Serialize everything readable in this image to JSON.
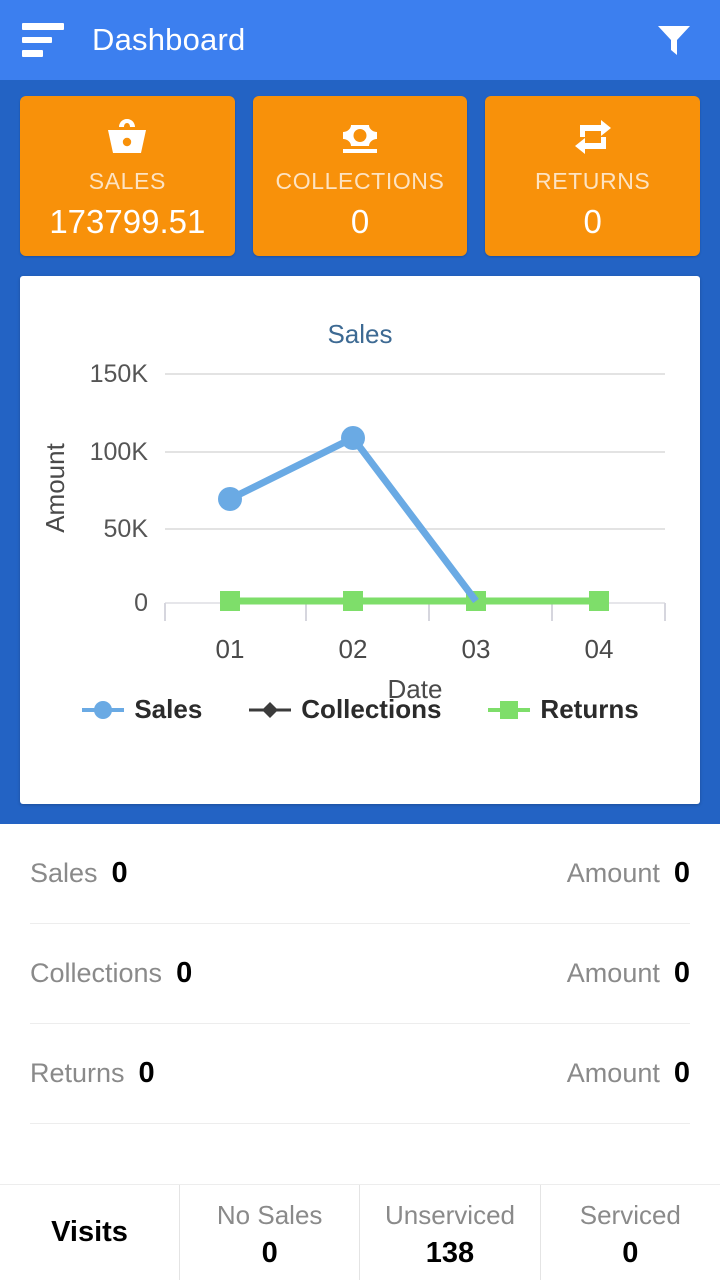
{
  "header": {
    "title": "Dashboard",
    "menu_icon": "hamburger-menu-icon",
    "filter_icon": "filter-funnel-icon"
  },
  "kpi_cards": [
    {
      "label": "SALES",
      "value": "173799.51",
      "icon": "shopping-basket-icon"
    },
    {
      "label": "COLLECTIONS",
      "value": "0",
      "icon": "banknote-icon"
    },
    {
      "label": "RETURNS",
      "value": "0",
      "icon": "repeat-arrows-icon"
    }
  ],
  "chart_data": {
    "type": "line",
    "title": "Sales",
    "xlabel": "Date",
    "ylabel": "Amount",
    "categories": [
      "01",
      "02",
      "03",
      "04"
    ],
    "ytick_labels": [
      "150K",
      "100K",
      "50K",
      "0"
    ],
    "ytick_values": [
      150000,
      100000,
      50000,
      0
    ],
    "ylim": [
      0,
      160000
    ],
    "grid": true,
    "legend_position": "bottom",
    "series": [
      {
        "name": "Sales",
        "color": "#6aaae4",
        "marker": "circle",
        "x": [
          "01",
          "02",
          "03"
        ],
        "values": [
          68000,
          109000,
          0
        ]
      },
      {
        "name": "Collections",
        "color": "#3b3b3b",
        "marker": "diamond",
        "x": [],
        "values": []
      },
      {
        "name": "Returns",
        "color": "#7ede6a",
        "marker": "square",
        "x": [
          "01",
          "02",
          "03",
          "04"
        ],
        "values": [
          0,
          0,
          0,
          0
        ]
      }
    ]
  },
  "summary_rows": [
    {
      "label": "Sales",
      "count": "0",
      "amount_label": "Amount",
      "amount": "0"
    },
    {
      "label": "Collections",
      "count": "0",
      "amount_label": "Amount",
      "amount": "0"
    },
    {
      "label": "Returns",
      "count": "0",
      "amount_label": "Amount",
      "amount": "0"
    }
  ],
  "bottom_bar": {
    "visits_label": "Visits",
    "stats": [
      {
        "label": "No Sales",
        "value": "0"
      },
      {
        "label": "Unserviced",
        "value": "138"
      },
      {
        "label": "Serviced",
        "value": "0"
      }
    ]
  },
  "colors": {
    "header_blue": "#3c7fef",
    "panel_blue": "#2363c4",
    "card_orange": "#f8910a",
    "sales_blue": "#6aaae4",
    "returns_green": "#7ede6a",
    "collections_dark": "#3b3b3b",
    "title_blue": "#3d6a93"
  }
}
